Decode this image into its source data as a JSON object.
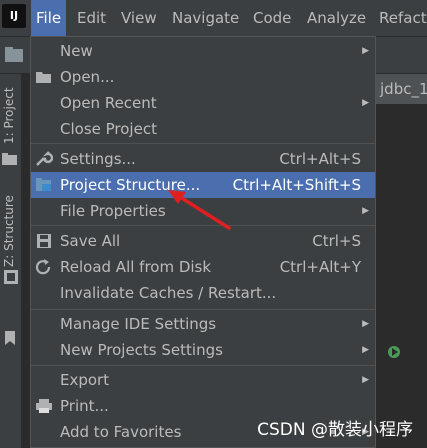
{
  "menubar": {
    "items": [
      "File",
      "Edit",
      "View",
      "Navigate",
      "Code",
      "Analyze",
      "Refacto"
    ],
    "active": "File",
    "app_icon_text": "IJ"
  },
  "side_tabs": {
    "project": "1: Project",
    "structure": "Z: Structure"
  },
  "editor_tab": {
    "label": "jdbc_1"
  },
  "file_menu": {
    "items": [
      {
        "label": "New",
        "shortcut": "",
        "submenu": true,
        "icon": ""
      },
      {
        "label": "Open...",
        "shortcut": "",
        "submenu": false,
        "icon": "folder-icon"
      },
      {
        "label": "Open Recent",
        "shortcut": "",
        "submenu": true,
        "icon": ""
      },
      {
        "label": "Close Project",
        "shortcut": "",
        "submenu": false,
        "icon": ""
      },
      {
        "label": "Settings...",
        "shortcut": "Ctrl+Alt+S",
        "submenu": false,
        "icon": "wrench-icon"
      },
      {
        "label": "Project Structure...",
        "shortcut": "Ctrl+Alt+Shift+S",
        "submenu": false,
        "icon": "project-structure-icon",
        "selected": true
      },
      {
        "label": "File Properties",
        "shortcut": "",
        "submenu": true,
        "icon": ""
      },
      {
        "label": "Save All",
        "shortcut": "Ctrl+S",
        "submenu": false,
        "icon": "save-icon"
      },
      {
        "label": "Reload All from Disk",
        "shortcut": "Ctrl+Alt+Y",
        "submenu": false,
        "icon": "reload-icon"
      },
      {
        "label": "Invalidate Caches / Restart...",
        "shortcut": "",
        "submenu": false,
        "icon": ""
      },
      {
        "label": "Manage IDE Settings",
        "shortcut": "",
        "submenu": true,
        "icon": ""
      },
      {
        "label": "New Projects Settings",
        "shortcut": "",
        "submenu": true,
        "icon": ""
      },
      {
        "label": "Export",
        "shortcut": "",
        "submenu": true,
        "icon": ""
      },
      {
        "label": "Print...",
        "shortcut": "",
        "submenu": false,
        "icon": "print-icon"
      },
      {
        "label": "Add to Favorites",
        "shortcut": "",
        "submenu": true,
        "icon": ""
      }
    ]
  },
  "watermark": "CSDN @散装小程序",
  "colors": {
    "selection": "#4b6eaf",
    "menu_bg": "#3c3f41",
    "annotation_arrow": "#e02020"
  }
}
